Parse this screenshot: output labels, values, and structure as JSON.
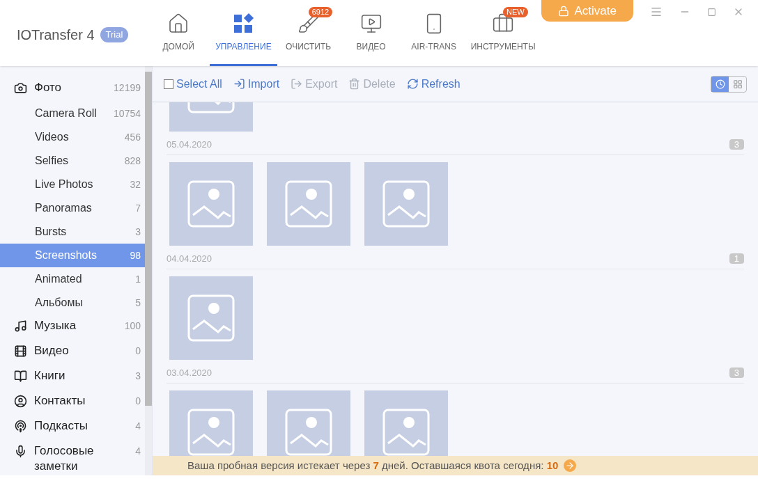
{
  "app": {
    "name": "IOTransfer 4",
    "badge": "Trial"
  },
  "nav": [
    {
      "label": "ДОМОЙ",
      "selected": false
    },
    {
      "label": "УПРАВЛЕНИЕ",
      "selected": true
    },
    {
      "label": "ОЧИСТИТЬ",
      "selected": false,
      "badge": "6912"
    },
    {
      "label": "ВИДЕО",
      "selected": false
    },
    {
      "label": "AIR-TRANS",
      "selected": false
    },
    {
      "label": "ИНСТРУМЕНТЫ",
      "selected": false,
      "badge": "NEW"
    }
  ],
  "activate": "Activate",
  "sidebar": [
    {
      "label": "Фото",
      "count": "12199",
      "selected": false,
      "children": [
        {
          "label": "Camera Roll",
          "count": "10754",
          "selected": false
        },
        {
          "label": "Videos",
          "count": "456",
          "selected": false
        },
        {
          "label": "Selfies",
          "count": "828",
          "selected": false
        },
        {
          "label": "Live Photos",
          "count": "32",
          "selected": false
        },
        {
          "label": "Panoramas",
          "count": "7",
          "selected": false
        },
        {
          "label": "Bursts",
          "count": "3",
          "selected": false
        },
        {
          "label": "Screenshots",
          "count": "98",
          "selected": true
        },
        {
          "label": "Animated",
          "count": "1",
          "selected": false
        },
        {
          "label": "Альбомы",
          "count": "5",
          "selected": false
        }
      ]
    },
    {
      "label": "Музыка",
      "count": "100",
      "selected": false
    },
    {
      "label": "Видео",
      "count": "0",
      "selected": false
    },
    {
      "label": "Книги",
      "count": "3",
      "selected": false
    },
    {
      "label": "Контакты",
      "count": "0",
      "selected": false
    },
    {
      "label": "Подкасты",
      "count": "4",
      "selected": false
    },
    {
      "label": "Голосовые заметки",
      "count": "4",
      "selected": false
    }
  ],
  "toolbar": [
    {
      "label": "Select All",
      "kind": "checkbox",
      "checked": false,
      "disabled": false
    },
    {
      "label": "Import",
      "kind": "import",
      "disabled": false
    },
    {
      "label": "Export",
      "kind": "export",
      "disabled": true
    },
    {
      "label": "Delete",
      "kind": "delete",
      "disabled": true
    },
    {
      "label": "Refresh",
      "kind": "refresh",
      "disabled": false
    }
  ],
  "view_modes": [
    {
      "kind": "timeline",
      "selected": true
    },
    {
      "kind": "grid",
      "selected": false
    }
  ],
  "groups": [
    {
      "date": "05.04.2020",
      "count": "3"
    },
    {
      "date": "04.04.2020",
      "count": "1"
    },
    {
      "date": "03.04.2020",
      "count": "3"
    }
  ],
  "banner": "Ваша пробная версия истекает через **7** дней. Оставшаяся квота сегодня: **10**"
}
